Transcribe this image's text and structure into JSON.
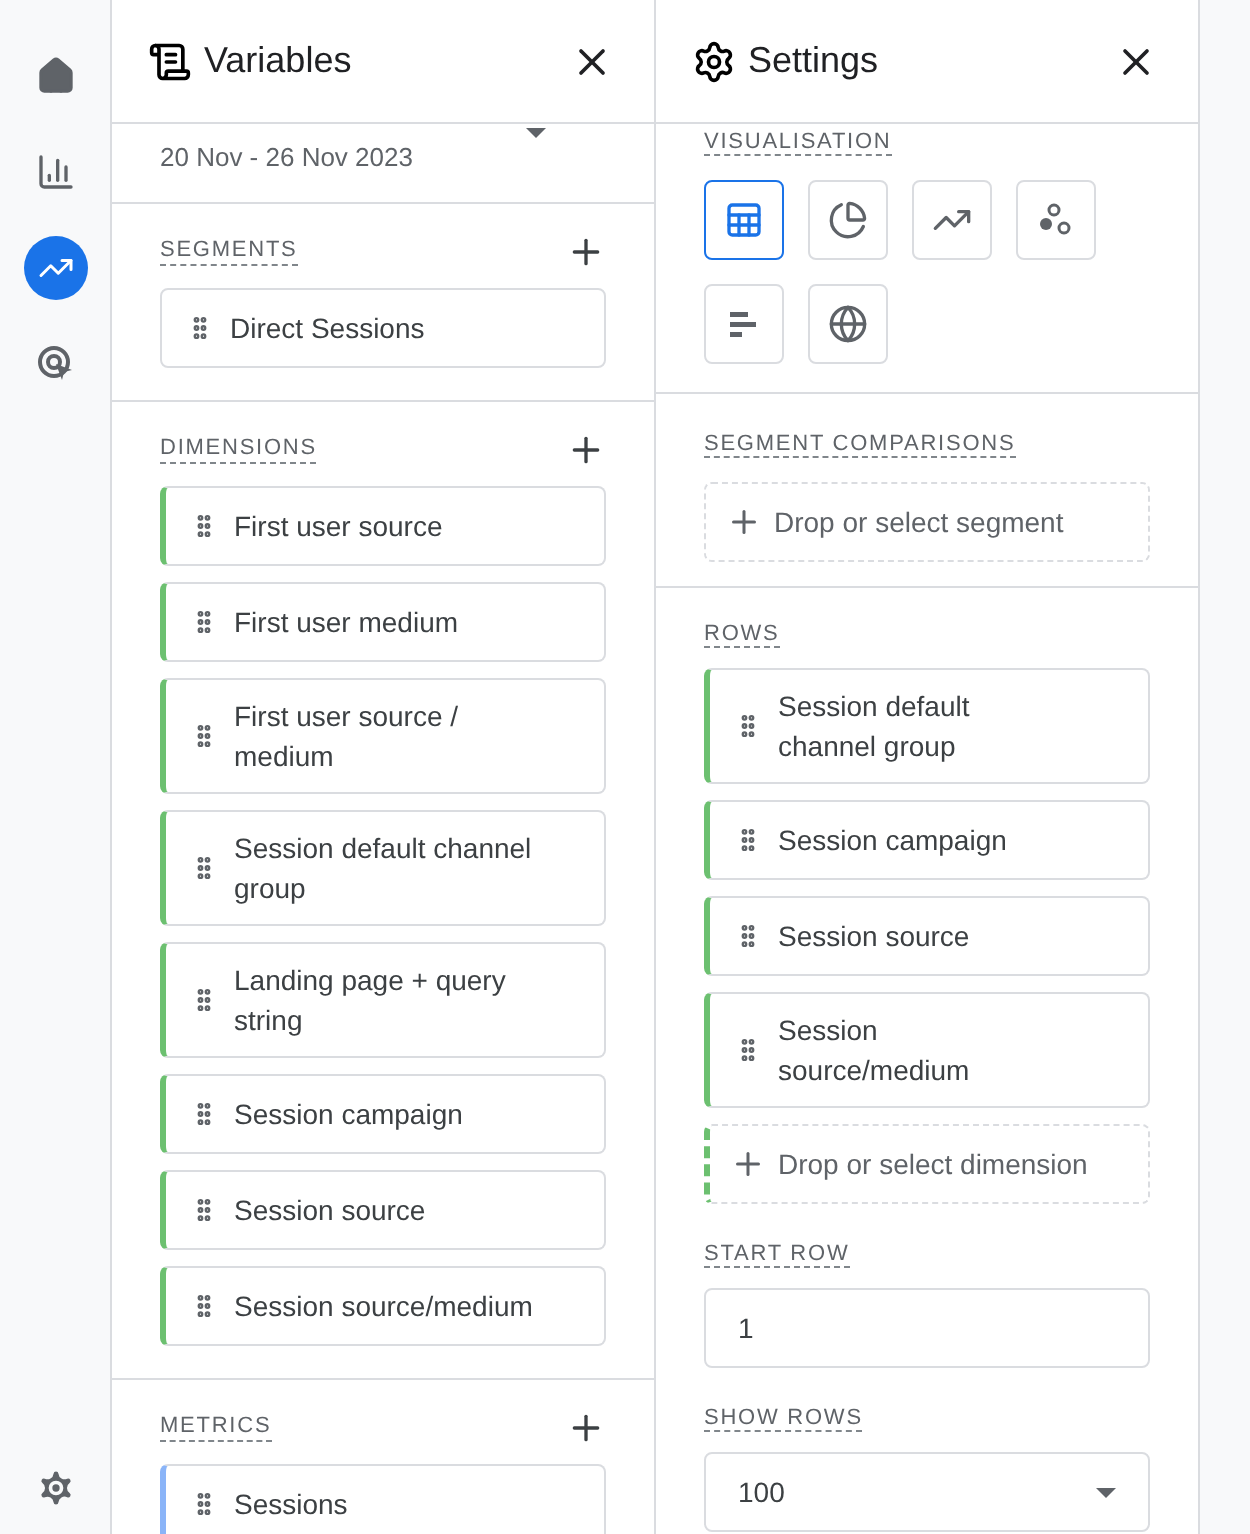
{
  "rail": [
    {
      "kind": "home",
      "selected": false
    },
    {
      "kind": "reports",
      "selected": false
    },
    {
      "kind": "explore",
      "selected": true
    },
    {
      "kind": "advertising",
      "selected": false
    }
  ],
  "variables": {
    "title": "Variables",
    "date_range": "20 Nov - 26 Nov 2023",
    "sections": [
      {
        "title": "SEGMENTS",
        "kind": "segment",
        "items": [
          "Direct Sessions"
        ]
      },
      {
        "title": "DIMENSIONS",
        "kind": "dimension",
        "items": [
          "First user source",
          "First user medium",
          "First user source / medium",
          "Session default channel group",
          "Landing page + query string",
          "Session campaign",
          "Session source",
          "Session source/medium"
        ]
      },
      {
        "title": "METRICS",
        "kind": "metric",
        "items": [
          "Sessions"
        ]
      }
    ]
  },
  "settings": {
    "title": "Settings",
    "visualisation": {
      "title": "VISUALISATION",
      "options": [
        {
          "kind": "table",
          "selected": true
        },
        {
          "kind": "donut",
          "selected": false
        },
        {
          "kind": "line",
          "selected": false
        },
        {
          "kind": "scatter",
          "selected": false
        },
        {
          "kind": "bar",
          "selected": false
        },
        {
          "kind": "geo",
          "selected": false
        }
      ]
    },
    "segment_comparisons": {
      "title": "SEGMENT COMPARISONS",
      "drop": "Drop or select segment"
    },
    "rows": {
      "title": "ROWS",
      "items": [
        "Session default channel group",
        "Session campaign",
        "Session source",
        "Session source/medium"
      ],
      "drop": "Drop or select dimension"
    },
    "start_row": {
      "title": "START ROW",
      "value": "1"
    },
    "show_rows": {
      "title": "SHOW ROWS",
      "value": "100"
    }
  }
}
